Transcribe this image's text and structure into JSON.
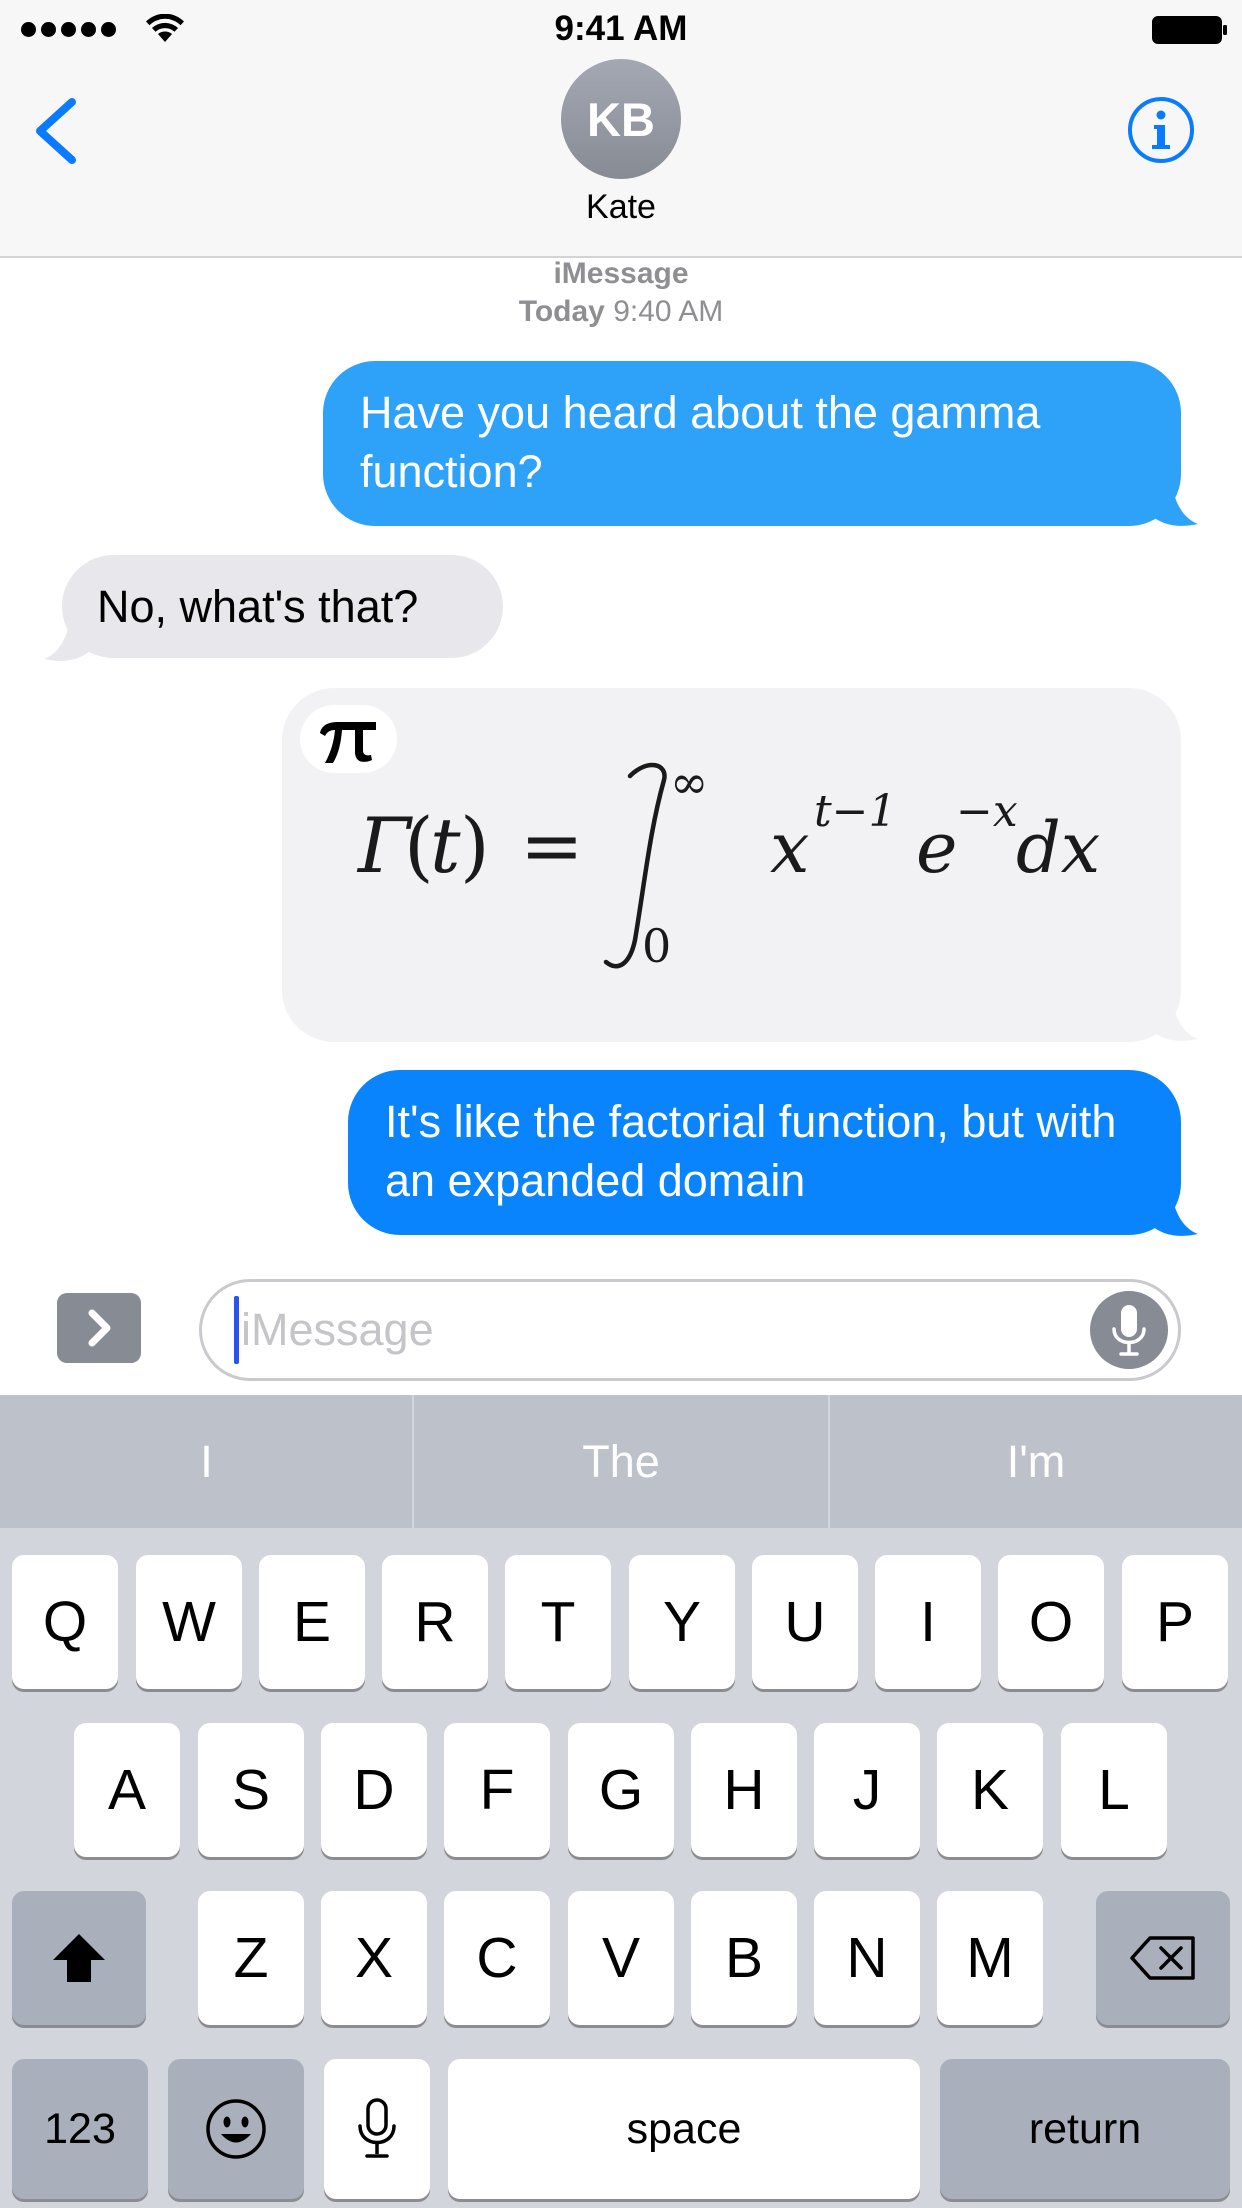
{
  "status_bar": {
    "time": "9:41 AM",
    "signal_bars": 5
  },
  "header": {
    "avatar_initials": "KB",
    "contact_name": "Kate"
  },
  "conversation": {
    "service": "iMessage",
    "timestamp_day": "Today",
    "timestamp_time": "9:40 AM",
    "messages": [
      {
        "from": "me",
        "text": "Have you heard about the gamma function?"
      },
      {
        "from": "them",
        "text": "No, what's that?"
      },
      {
        "from": "me",
        "type": "math",
        "app_icon": "π",
        "formula": "Γ(t) = ∫₀^∞ x^{t−1} e^{−x} dx"
      },
      {
        "from": "me",
        "text": "It's like the factorial function, but with an expanded domain"
      }
    ]
  },
  "composer": {
    "placeholder": "iMessage"
  },
  "keyboard": {
    "suggestions": [
      "I",
      "The",
      "I'm"
    ],
    "row1": [
      "Q",
      "W",
      "E",
      "R",
      "T",
      "Y",
      "U",
      "I",
      "O",
      "P"
    ],
    "row2": [
      "A",
      "S",
      "D",
      "F",
      "G",
      "H",
      "J",
      "K",
      "L"
    ],
    "row3": [
      "Z",
      "X",
      "C",
      "V",
      "B",
      "N",
      "M"
    ],
    "numbers_label": "123",
    "space_label": "space",
    "return_label": "return"
  },
  "colors": {
    "outgoing_bubble_1": "#2ea1f8",
    "outgoing_bubble_2": "#0a84fc",
    "incoming_bubble": "#e7e7ec",
    "accent": "#0a7bff"
  }
}
